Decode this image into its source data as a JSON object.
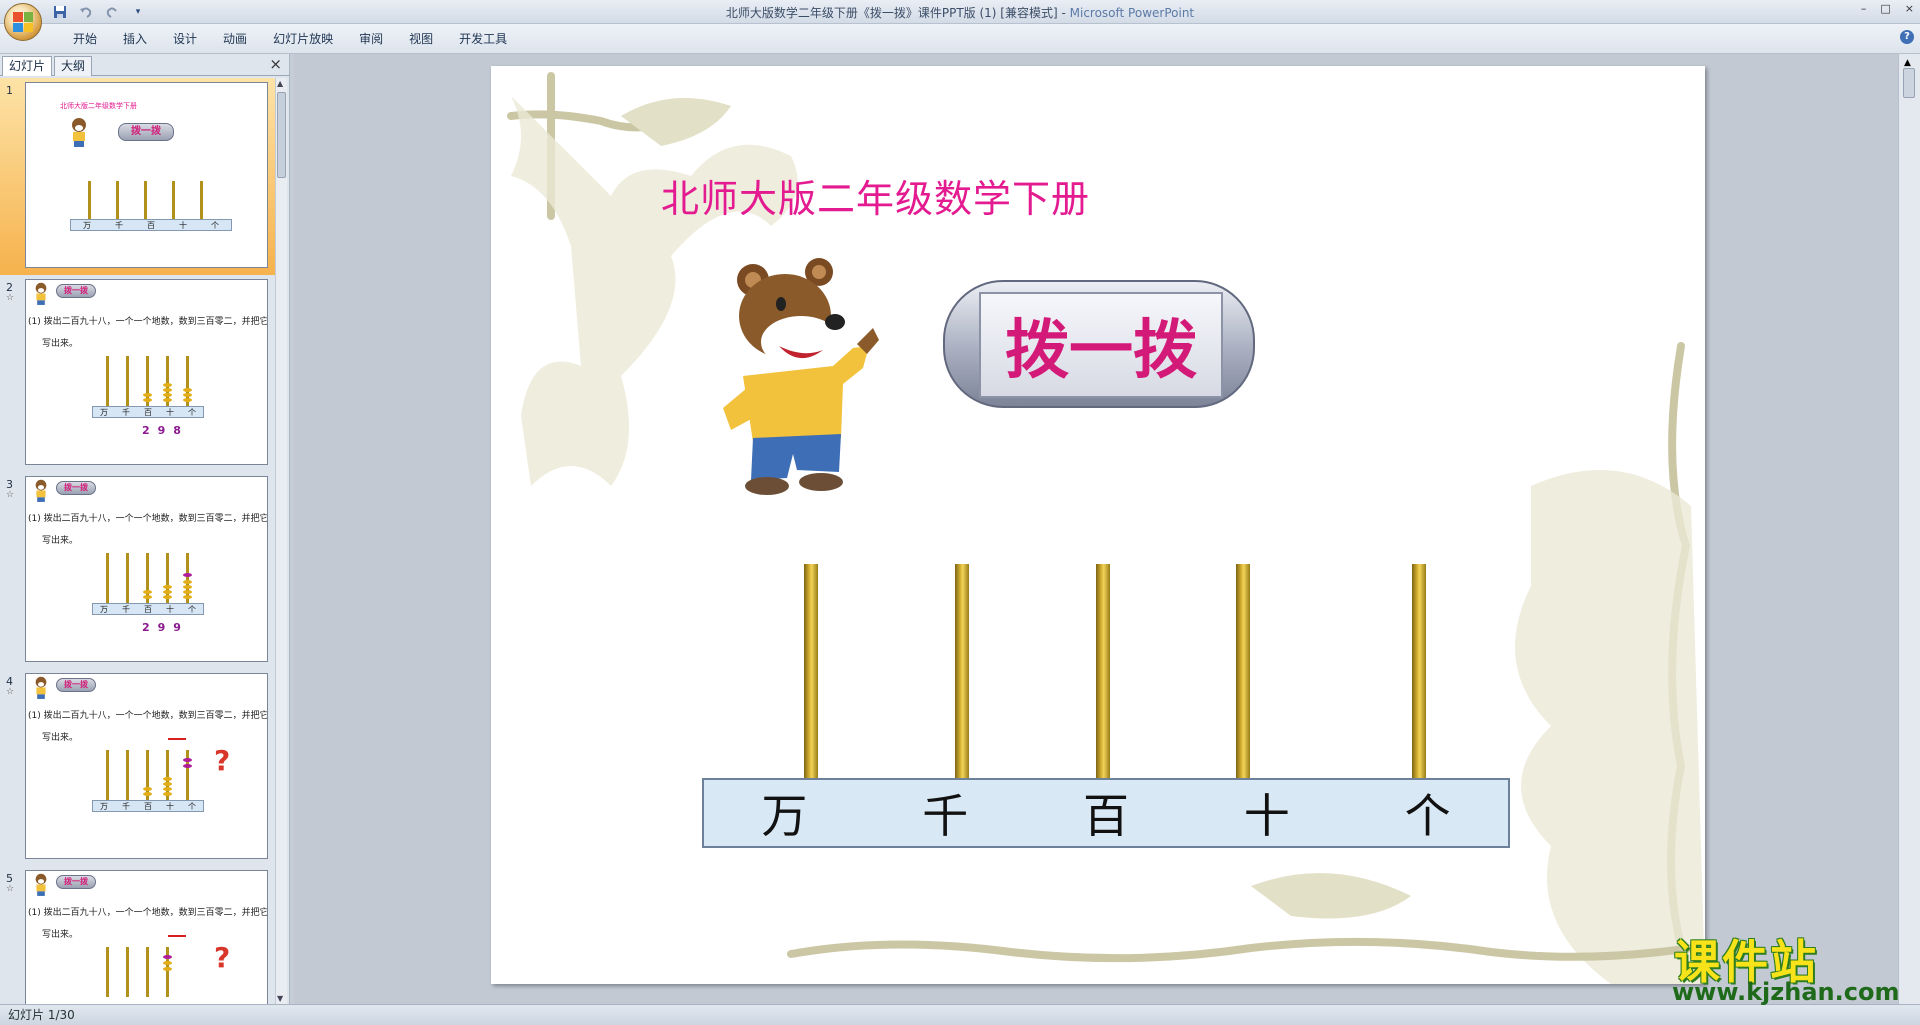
{
  "window": {
    "title": "北师大版数学二年级下册《拨一拨》课件PPT版 (1) [兼容模式] - ",
    "app_name": "Microsoft PowerPoint",
    "controls": [
      "–",
      "□",
      "×"
    ]
  },
  "quick_access": {
    "save_icon": "save-icon",
    "undo_icon": "undo-icon",
    "redo_icon": "redo-icon"
  },
  "ribbon": {
    "tabs": [
      "开始",
      "插入",
      "设计",
      "动画",
      "幻灯片放映",
      "审阅",
      "视图",
      "开发工具"
    ],
    "help": "?"
  },
  "left_panel": {
    "tabs": [
      "幻灯片",
      "大纲"
    ],
    "close": "×",
    "thumbnails": [
      {
        "number": "1",
        "title": "北师大版二年级数学下册",
        "sign": "拨一拨",
        "base_labels": [
          "万",
          "千",
          "百",
          "十",
          "个"
        ]
      },
      {
        "number": "2",
        "sign": "拨一拨",
        "line1": "(1) 拨出二百九十八，一个一个地数，数到三百零二，并把它们",
        "line2": "写出来。",
        "base_labels": [
          "万",
          "千",
          "百",
          "十",
          "个"
        ],
        "digits": "298"
      },
      {
        "number": "3",
        "sign": "拨一拨",
        "line1": "(1) 拨出二百九十八，一个一个地数，数到三百零二，并把它们",
        "line2": "写出来。",
        "base_labels": [
          "万",
          "千",
          "百",
          "十",
          "个"
        ],
        "digits": "299"
      },
      {
        "number": "4",
        "sign": "拨一拨",
        "line1": "(1) 拨出二百九十八，一个一个地数，数到三百零二，并把它们",
        "line2": "写出来。",
        "base_labels": [
          "万",
          "千",
          "百",
          "十",
          "个"
        ],
        "question": "?"
      },
      {
        "number": "5",
        "sign": "拨一拨",
        "line1": "(1) 拨出二百九十八，一个一个地数，数到三百零二，并把它们",
        "line2": "写出来。",
        "question": "?"
      }
    ]
  },
  "slide": {
    "title": "北师大版二年级数学下册",
    "sign": "拨一拨",
    "base_labels": [
      "万",
      "千",
      "百",
      "十",
      "个"
    ]
  },
  "status": {
    "text": "幻灯片 1/30"
  },
  "watermark": {
    "cn": "课件站",
    "url": "www.kjzhan.com"
  }
}
